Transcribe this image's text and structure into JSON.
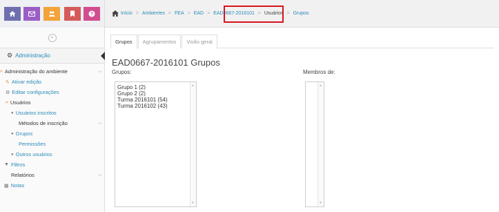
{
  "toolbar": {
    "buttons": [
      {
        "icon": "home-icon",
        "color": "#6f6fb0"
      },
      {
        "icon": "mail-icon",
        "color": "#9a5ec6"
      },
      {
        "icon": "users-icon",
        "color": "#f2a33a"
      },
      {
        "icon": "bookmark-icon",
        "color": "#d65a5a"
      },
      {
        "icon": "help-icon",
        "color": "#d24d8f"
      }
    ]
  },
  "breadcrumb": {
    "items": [
      "Início",
      "Ambientes",
      "FEA",
      "EAD",
      "EAD0667-2016101",
      "Usuários",
      "Grupos"
    ],
    "separator": ">"
  },
  "sidebar": {
    "collapse_glyph": "«",
    "header": "Administração",
    "items": [
      {
        "label": "Administração do ambiente",
        "icon": "»"
      },
      {
        "label": "Ativar edição",
        "icon": "✎"
      },
      {
        "label": "Editar configurações",
        "icon": "⚙"
      },
      {
        "label": "Usuários",
        "icon": "»"
      },
      {
        "label": "Usuários inscritos",
        "icon": "👤"
      },
      {
        "label": "Métodos de inscrição"
      },
      {
        "label": "Grupos",
        "icon": "👥"
      },
      {
        "label": "Permissões"
      },
      {
        "label": "Outros usuários",
        "icon": "👤"
      },
      {
        "label": "Filtros",
        "icon": "▼"
      },
      {
        "label": "Relatórios"
      },
      {
        "label": "Notas",
        "icon": "▦"
      }
    ]
  },
  "tabs": [
    "Grupos",
    "Agrupamentos",
    "Visão geral"
  ],
  "page_title": "EAD0667-2016101 Grupos",
  "groups_label": "Grupos:",
  "members_label": "Membros de:",
  "groups": [
    "Grupo 1 (2)",
    "Grupo 2 (2)",
    "Turma 2016101 (54)",
    "Turma 2016102 (43)"
  ],
  "colors": {
    "link": "#2a8ab8",
    "highlight": "#d7131c",
    "accent": "#e6892b"
  }
}
